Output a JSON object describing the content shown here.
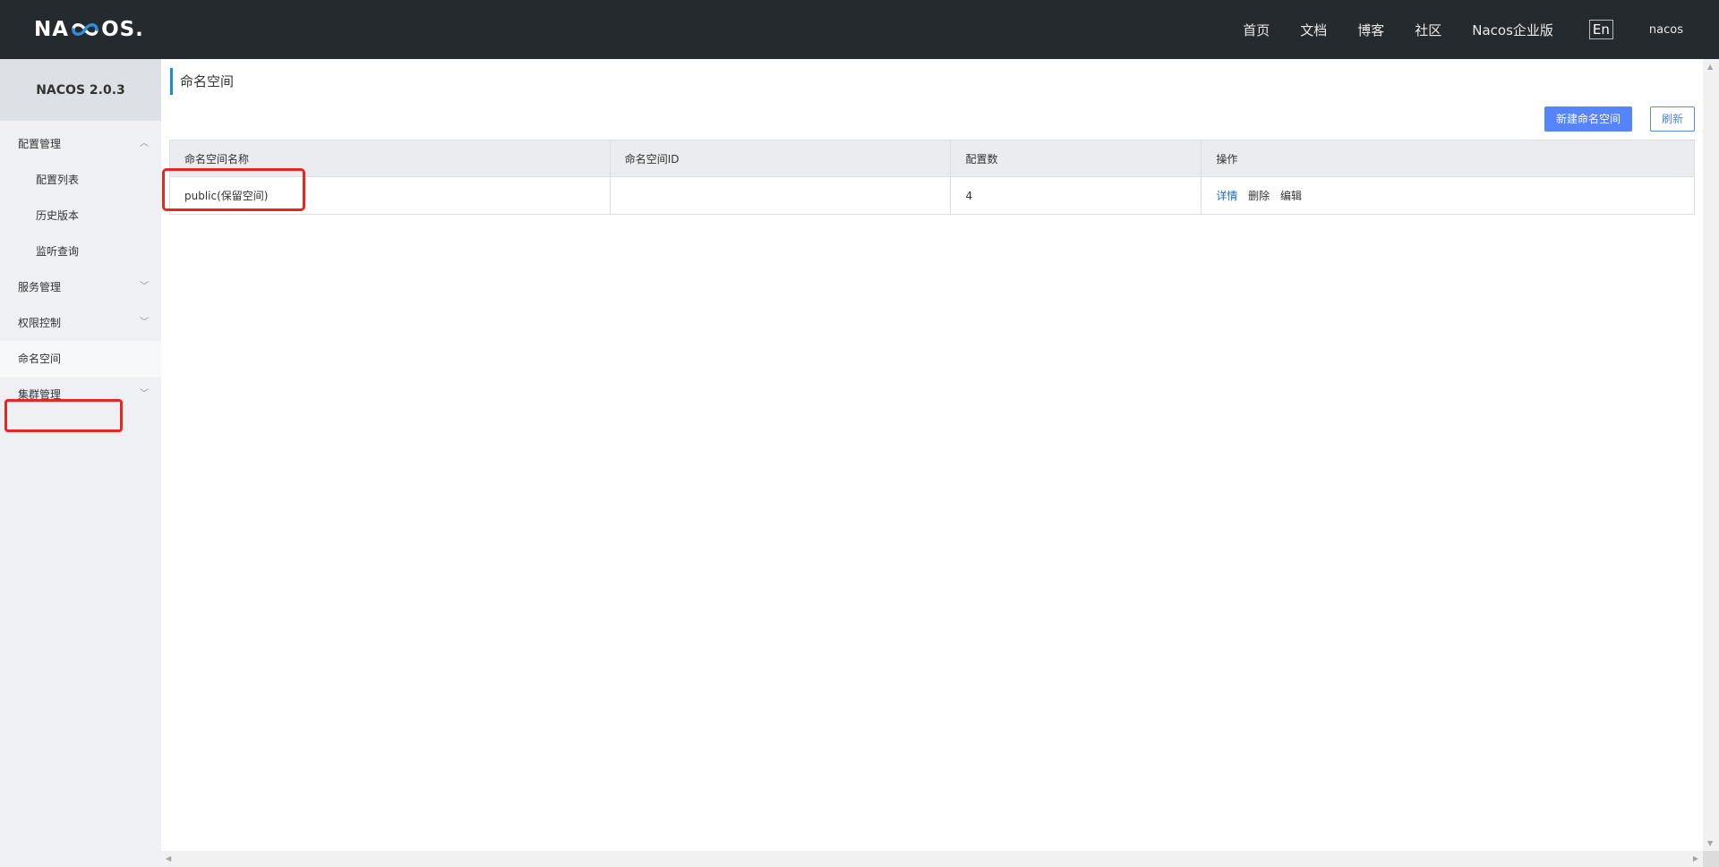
{
  "header": {
    "logo_left": "NA",
    "logo_right": "OS.",
    "nav": [
      "首页",
      "文档",
      "博客",
      "社区",
      "Nacos企业版"
    ],
    "lang": "En",
    "user": "nacos"
  },
  "sidebar": {
    "brand": "NACOS 2.0.3",
    "items": [
      {
        "label": "配置管理"
      },
      {
        "label": "配置列表"
      },
      {
        "label": "历史版本"
      },
      {
        "label": "监听查询"
      },
      {
        "label": "服务管理"
      },
      {
        "label": "权限控制"
      },
      {
        "label": "命名空间"
      },
      {
        "label": "集群管理"
      }
    ]
  },
  "main": {
    "title": "命名空间",
    "new_button": "新建命名空间",
    "refresh_button": "刷新",
    "table": {
      "headers": [
        "命名空间名称",
        "命名空间ID",
        "配置数",
        "操作"
      ],
      "rows": [
        {
          "name": "public(保留空间)",
          "id": "",
          "count": "4",
          "ops": [
            "详情",
            "删除",
            "编辑"
          ]
        }
      ]
    }
  },
  "colors": {
    "header_bg": "#252a2f",
    "sidebar_bg": "#eef0f4",
    "primary": "#5584ff",
    "link": "#1a6dcc",
    "highlight": "#e6261f"
  }
}
